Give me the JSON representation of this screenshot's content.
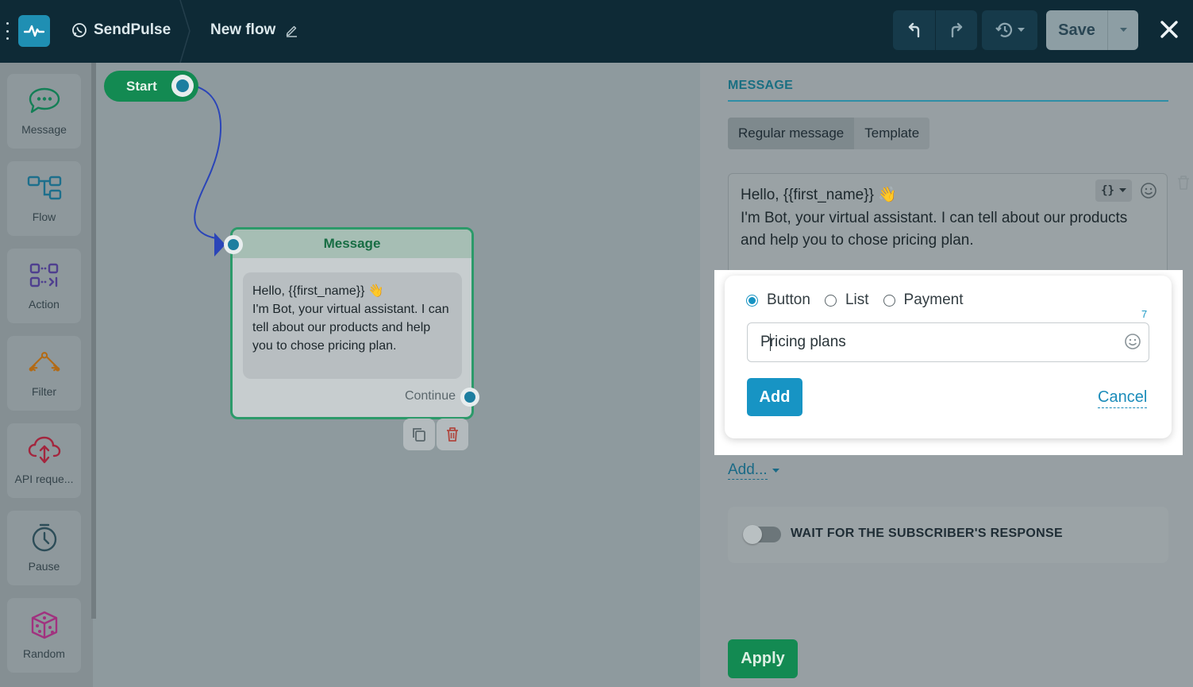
{
  "header": {
    "brand": "SendPulse",
    "flow_title": "New flow",
    "save_label": "Save"
  },
  "sidebar": {
    "items": [
      {
        "label": "Message",
        "icon": "message-icon"
      },
      {
        "label": "Flow",
        "icon": "flow-icon"
      },
      {
        "label": "Action",
        "icon": "action-icon"
      },
      {
        "label": "Filter",
        "icon": "filter-icon"
      },
      {
        "label": "API reque...",
        "icon": "api-request-icon"
      },
      {
        "label": "Pause",
        "icon": "pause-icon"
      },
      {
        "label": "Random",
        "icon": "random-icon"
      }
    ]
  },
  "canvas": {
    "start_label": "Start",
    "message_node": {
      "title": "Message",
      "text": "Hello, {{first_name}} 👋\nI'm Bot, your virtual assistant. I can tell about our products and help you to chose pricing plan.",
      "continue_label": "Continue"
    }
  },
  "panel": {
    "title": "MESSAGE",
    "tabs": [
      "Regular message",
      "Template"
    ],
    "active_tab": "Regular message",
    "message_text": "Hello, {{first_name}} 👋\nI'm Bot, your virtual assistant. I can tell about our products and help you to chose pricing plan.",
    "popup": {
      "options": [
        "Button",
        "List",
        "Payment"
      ],
      "selected": "Button",
      "char_count": "7",
      "input_value_before_caret": "P",
      "input_value_after_caret": "ricing plans",
      "add_label": "Add",
      "cancel_label": "Cancel"
    },
    "add_dropdown_label": "Add...",
    "wait_label": "WAIT FOR THE SUBSCRIBER'S RESPONSE",
    "wait_enabled": false,
    "apply_label": "Apply"
  },
  "colors": {
    "topbar": "#0e2a36",
    "brand_green": "#138a52",
    "accent_blue": "#1794c4"
  }
}
